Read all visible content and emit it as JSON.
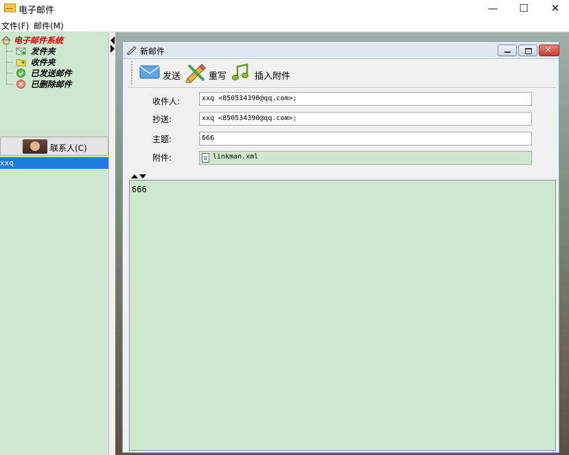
{
  "window": {
    "title": "电子邮件",
    "controls": {
      "minimize": "—",
      "maximize": "☐",
      "close": "✕"
    }
  },
  "menu": [
    "文件(F)",
    "邮件(M)"
  ],
  "tree": {
    "root": "电子邮件系统",
    "items": [
      {
        "label": "发件夹",
        "icon": "outbox-icon"
      },
      {
        "label": "收件夹",
        "icon": "inbox-folder-icon"
      },
      {
        "label": "已发送邮件",
        "icon": "sent-check-icon"
      },
      {
        "label": "已删除邮件",
        "icon": "deleted-x-icon"
      }
    ]
  },
  "contacts": {
    "header": "联系人(C)",
    "items": [
      "xxq"
    ],
    "selected": "xxq"
  },
  "compose": {
    "title": "新邮件",
    "toolbar": {
      "send": "发送",
      "rewrite": "重写",
      "attach": "插入附件"
    },
    "fields": {
      "to_label": "收件人:",
      "to_value": "xxq <850534390@qq.com>;",
      "cc_label": "抄送:",
      "cc_value": "xxq <850534390@qq.com>;",
      "subject_label": "主题:",
      "subject_value": "666",
      "attachment_label": "附件:",
      "attachment_file": "linkman.xml"
    },
    "body": "666"
  },
  "colors": {
    "panel_green": "#cde8cf",
    "selection_blue": "#1f7ae0",
    "tree_root_red": "#e00000"
  }
}
